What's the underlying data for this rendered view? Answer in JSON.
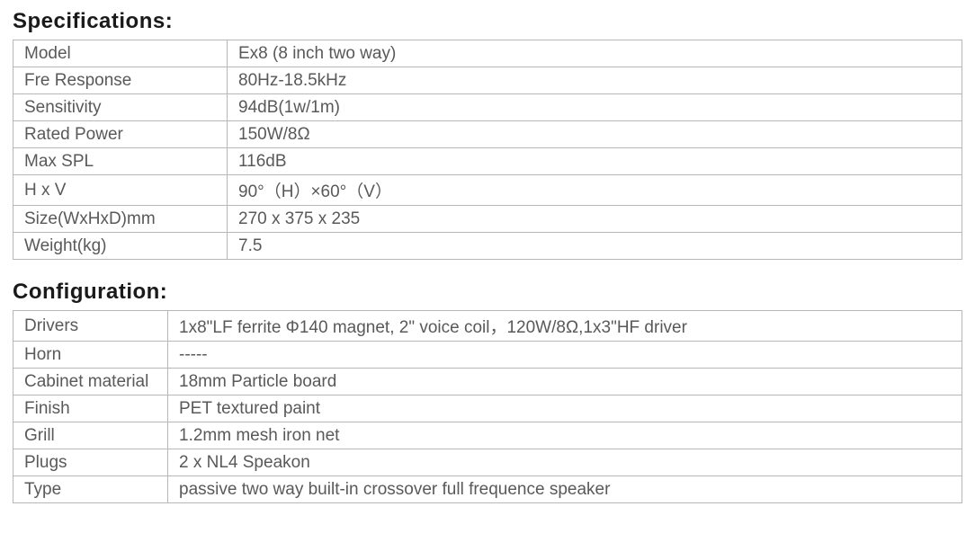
{
  "specifications": {
    "title": "Specifications:",
    "rows": [
      {
        "label": "Model",
        "value": "Ex8 (8 inch two way)"
      },
      {
        "label": "Fre  Response",
        "value": "80Hz-18.5kHz"
      },
      {
        "label": "Sensitivity",
        "value": "94dB(1w/1m)"
      },
      {
        "label": "Rated Power",
        "value": "150W/8Ω"
      },
      {
        "label": "Max SPL",
        "value": "116dB"
      },
      {
        "label": "H x V",
        "value": "90°（H）×60°（V）"
      },
      {
        "label": "Size(WxHxD)mm",
        "value": "270 x 375 x 235"
      },
      {
        "label": "Weight(kg)",
        "value": "7.5"
      }
    ]
  },
  "configuration": {
    "title": "Configuration:",
    "rows": [
      {
        "label": "Drivers",
        "value": "1x8\"LF ferrite Φ140 magnet, 2\" voice coil，120W/8Ω,1x3\"HF driver"
      },
      {
        "label": "Horn",
        "value": "-----"
      },
      {
        "label": "Cabinet material",
        "value": "18mm Particle board"
      },
      {
        "label": "Finish",
        "value": "PET textured paint"
      },
      {
        "label": "Grill",
        "value": "1.2mm mesh iron net"
      },
      {
        "label": "Plugs",
        "value": "2 x NL4 Speakon"
      },
      {
        "label": "Type",
        "value": "passive two way built-in crossover full frequence speaker"
      }
    ]
  }
}
